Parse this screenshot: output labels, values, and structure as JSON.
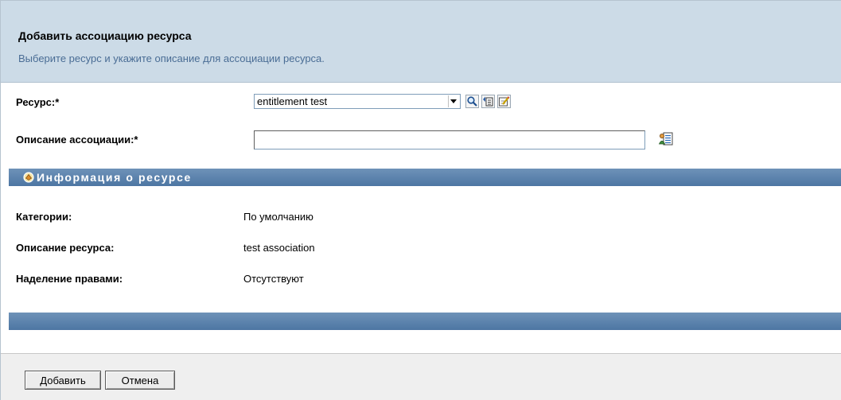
{
  "header": {
    "title": "Добавить ассоциацию ресурса",
    "subtitle": "Выберите ресурс и укажите описание для ассоциации ресурса."
  },
  "form": {
    "resource_label": "Ресурс:*",
    "resource_value": "entitlement test",
    "description_label": "Описание ассоциации:*",
    "description_value": ""
  },
  "icons": {
    "resource_search": "search-icon",
    "resource_details": "tree-details-icon",
    "resource_edit": "edit-icon",
    "description_edit": "text-editor-icon",
    "section": "resource-info-icon"
  },
  "resource_info": {
    "title": "Информация о ресурсе",
    "rows": [
      {
        "label": "Категории:",
        "value": "По умолчанию"
      },
      {
        "label": "Описание ресурса:",
        "value": "test association"
      },
      {
        "label": "Наделение правами:",
        "value": "Отсутствуют"
      }
    ]
  },
  "footer": {
    "add_label": "Добавить",
    "cancel_label": "Отмена"
  },
  "colors": {
    "header_bg": "#ccdbe7",
    "subtitle": "#4a6d95",
    "section_bar": "#5a7fa9"
  }
}
